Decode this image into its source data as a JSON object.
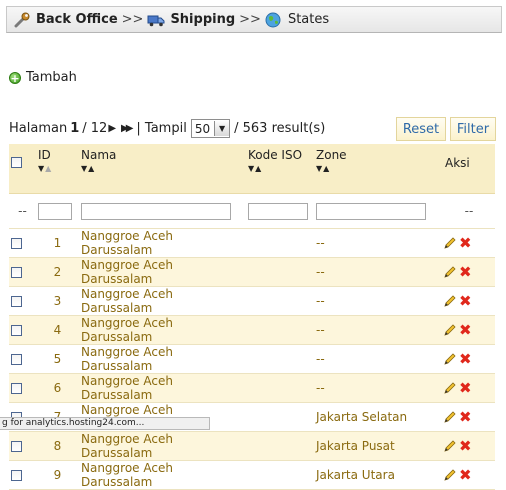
{
  "breadcrumb": {
    "items": [
      {
        "label": "Back Office",
        "icon": "wrench-icon",
        "bold": true
      },
      {
        "label": "Shipping",
        "icon": "truck-icon",
        "bold": true
      },
      {
        "label": "States",
        "icon": "globe-icon",
        "bold": false
      }
    ],
    "separator": ">>"
  },
  "add_link": {
    "label": "Tambah",
    "icon": "add-icon"
  },
  "pager": {
    "label": "Halaman",
    "current": "1",
    "total": "/ 12",
    "show_label": "| Tampil",
    "per_page": "50",
    "results": "/ 563 result(s)"
  },
  "buttons": {
    "reset": "Reset",
    "filter": "Filter"
  },
  "table": {
    "headers": {
      "id": "ID",
      "nama": "Nama",
      "kode_iso": "Kode ISO",
      "zone": "Zone",
      "aksi": "Aksi"
    },
    "filter_placeholder": "--",
    "rows": [
      {
        "id": "1",
        "nama": "Nanggroe Aceh Darussalam",
        "kode_iso": "",
        "zone": "--"
      },
      {
        "id": "2",
        "nama": "Nanggroe Aceh Darussalam",
        "kode_iso": "",
        "zone": "--"
      },
      {
        "id": "3",
        "nama": "Nanggroe Aceh Darussalam",
        "kode_iso": "",
        "zone": "--"
      },
      {
        "id": "4",
        "nama": "Nanggroe Aceh Darussalam",
        "kode_iso": "",
        "zone": "--"
      },
      {
        "id": "5",
        "nama": "Nanggroe Aceh Darussalam",
        "kode_iso": "",
        "zone": "--"
      },
      {
        "id": "6",
        "nama": "Nanggroe Aceh Darussalam",
        "kode_iso": "",
        "zone": "--"
      },
      {
        "id": "7",
        "nama": "Nanggroe Aceh Darussalam",
        "kode_iso": "",
        "zone": "Jakarta Selatan"
      },
      {
        "id": "8",
        "nama": "Nanggroe Aceh Darussalam",
        "kode_iso": "",
        "zone": "Jakarta Pusat"
      },
      {
        "id": "9",
        "nama": "Nanggroe Aceh Darussalam",
        "kode_iso": "",
        "zone": "Jakarta Utara"
      }
    ]
  },
  "status_bar": {
    "text": "g for analytics.hosting24.com..."
  },
  "colors": {
    "accent": "#2f6aa8",
    "header_bg": "#f8eec7",
    "row_alt": "#fdf6dc",
    "row_text": "#8a6a10",
    "delete": "#e0281c"
  }
}
